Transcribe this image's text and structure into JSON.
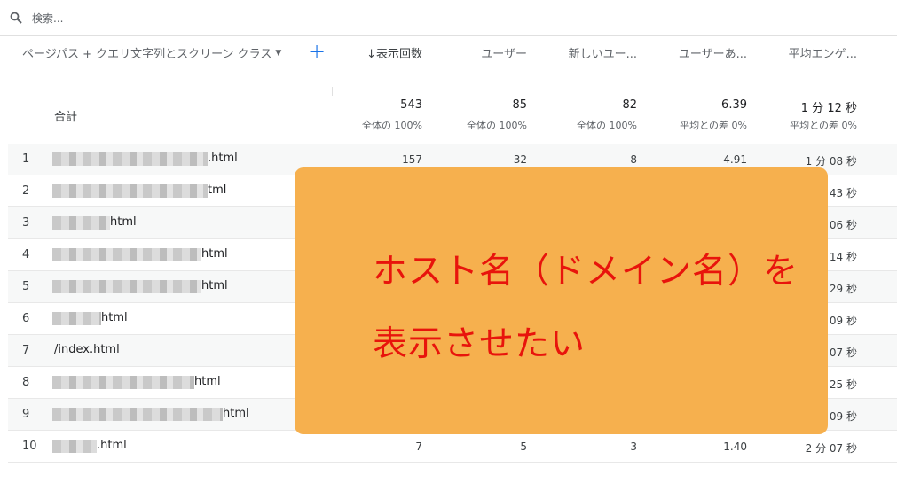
{
  "search": {
    "placeholder": "検索..."
  },
  "table": {
    "dimension_header": "ページパス + クエリ文字列とスクリーン クラス",
    "add_label": "+",
    "columns": [
      {
        "label": "↓表示回数",
        "total": "543",
        "total_sub": "全体の 100%"
      },
      {
        "label": "ユーザー",
        "total": "85",
        "total_sub": "全体の 100%"
      },
      {
        "label": "新しいユー...",
        "total": "82",
        "total_sub": "全体の 100%"
      },
      {
        "label": "ユーザーあ...",
        "total": "6.39",
        "total_sub": "平均との差 0%"
      },
      {
        "label": "平均エンゲ...",
        "total": "1 分 12 秒",
        "total_sub": "平均との差 0%"
      }
    ],
    "total_label": "合計",
    "rows": [
      {
        "index": "1",
        "path": ".html",
        "values": [
          "157",
          "32",
          "8",
          "4.91",
          "1 分 08 秒"
        ]
      },
      {
        "index": "2",
        "path": "tml",
        "values": [
          "",
          "",
          "",
          "",
          "43 秒"
        ]
      },
      {
        "index": "3",
        "path": "html",
        "values": [
          "",
          "",
          "",
          "",
          "06 秒"
        ]
      },
      {
        "index": "4",
        "path": "html",
        "values": [
          "",
          "",
          "",
          "",
          "14 秒"
        ]
      },
      {
        "index": "5",
        "path": "html",
        "values": [
          "",
          "",
          "",
          "",
          "29 秒"
        ]
      },
      {
        "index": "6",
        "path": "html",
        "values": [
          "",
          "",
          "",
          "",
          "09 秒"
        ]
      },
      {
        "index": "7",
        "path": "/index.html",
        "values": [
          "",
          "",
          "",
          "",
          "07 秒"
        ]
      },
      {
        "index": "8",
        "path": "html",
        "values": [
          "",
          "",
          "",
          "",
          "25 秒"
        ]
      },
      {
        "index": "9",
        "path": "html",
        "values": [
          "",
          "",
          "",
          "",
          "09 秒"
        ]
      },
      {
        "index": "10",
        "path": ".html",
        "values": [
          "7",
          "5",
          "3",
          "1.40",
          "2 分 07 秒"
        ]
      }
    ]
  },
  "overlay": {
    "line1": "ホスト名（ドメイン名）を",
    "line2": "表示させたい"
  }
}
